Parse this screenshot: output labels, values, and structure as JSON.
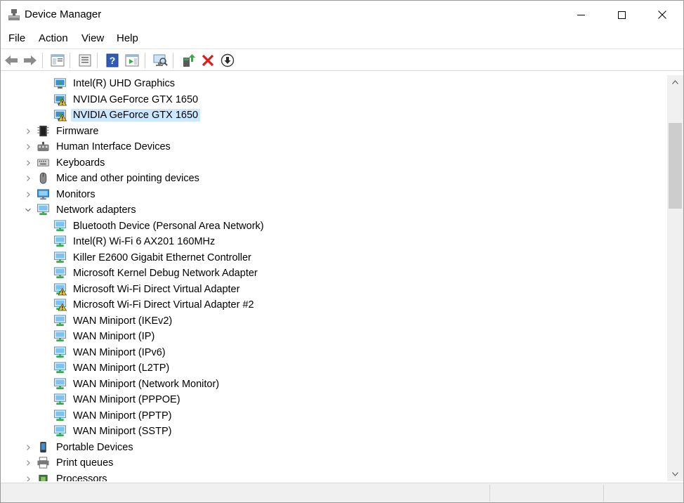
{
  "window": {
    "title": "Device Manager",
    "controls": {
      "minimize": "minimize",
      "maximize": "maximize",
      "close": "close"
    }
  },
  "menu": {
    "items": [
      {
        "label": "File"
      },
      {
        "label": "Action"
      },
      {
        "label": "View"
      },
      {
        "label": "Help"
      }
    ]
  },
  "toolbar": {
    "buttons": [
      {
        "icon": "back-arrow-icon"
      },
      {
        "icon": "forward-arrow-icon"
      },
      {
        "icon": "show-hide-console-tree-icon"
      },
      {
        "icon": "properties-icon"
      },
      {
        "icon": "help-icon"
      },
      {
        "icon": "action-pane-icon"
      },
      {
        "icon": "scan-hardware-changes-icon"
      },
      {
        "icon": "update-driver-icon"
      },
      {
        "icon": "uninstall-device-icon"
      },
      {
        "icon": "disable-device-icon"
      }
    ]
  },
  "tree": {
    "rows": [
      {
        "label": "Intel(R) UHD Graphics",
        "level": 2,
        "icon": "display-adapter-icon",
        "warning": false
      },
      {
        "label": "NVIDIA GeForce GTX 1650",
        "level": 2,
        "icon": "display-adapter-icon",
        "warning": true
      },
      {
        "label": "NVIDIA GeForce GTX 1650",
        "level": 2,
        "icon": "display-adapter-icon",
        "warning": true,
        "selected": true
      },
      {
        "label": "Firmware",
        "level": 1,
        "icon": "firmware-icon",
        "expander": "collapsed"
      },
      {
        "label": "Human Interface Devices",
        "level": 1,
        "icon": "hid-icon",
        "expander": "collapsed"
      },
      {
        "label": "Keyboards",
        "level": 1,
        "icon": "keyboard-icon",
        "expander": "collapsed"
      },
      {
        "label": "Mice and other pointing devices",
        "level": 1,
        "icon": "mouse-icon",
        "expander": "collapsed"
      },
      {
        "label": "Monitors",
        "level": 1,
        "icon": "monitor-icon",
        "expander": "collapsed"
      },
      {
        "label": "Network adapters",
        "level": 1,
        "icon": "network-adapter-icon",
        "expander": "expanded"
      },
      {
        "label": "Bluetooth Device (Personal Area Network)",
        "level": 2,
        "icon": "network-adapter-icon",
        "warning": false
      },
      {
        "label": "Intel(R) Wi-Fi 6 AX201 160MHz",
        "level": 2,
        "icon": "network-adapter-icon",
        "warning": false
      },
      {
        "label": "Killer E2600 Gigabit Ethernet Controller",
        "level": 2,
        "icon": "network-adapter-icon",
        "warning": false
      },
      {
        "label": "Microsoft Kernel Debug Network Adapter",
        "level": 2,
        "icon": "network-adapter-icon",
        "warning": false
      },
      {
        "label": "Microsoft Wi-Fi Direct Virtual Adapter",
        "level": 2,
        "icon": "network-adapter-icon",
        "warning": true
      },
      {
        "label": "Microsoft Wi-Fi Direct Virtual Adapter #2",
        "level": 2,
        "icon": "network-adapter-icon",
        "warning": true
      },
      {
        "label": "WAN Miniport (IKEv2)",
        "level": 2,
        "icon": "network-adapter-icon",
        "warning": false
      },
      {
        "label": "WAN Miniport (IP)",
        "level": 2,
        "icon": "network-adapter-icon",
        "warning": false
      },
      {
        "label": "WAN Miniport (IPv6)",
        "level": 2,
        "icon": "network-adapter-icon",
        "warning": false
      },
      {
        "label": "WAN Miniport (L2TP)",
        "level": 2,
        "icon": "network-adapter-icon",
        "warning": false
      },
      {
        "label": "WAN Miniport (Network Monitor)",
        "level": 2,
        "icon": "network-adapter-icon",
        "warning": false
      },
      {
        "label": "WAN Miniport (PPPOE)",
        "level": 2,
        "icon": "network-adapter-icon",
        "warning": false
      },
      {
        "label": "WAN Miniport (PPTP)",
        "level": 2,
        "icon": "network-adapter-icon",
        "warning": false
      },
      {
        "label": "WAN Miniport (SSTP)",
        "level": 2,
        "icon": "network-adapter-icon",
        "warning": false
      },
      {
        "label": "Portable Devices",
        "level": 1,
        "icon": "portable-device-icon",
        "expander": "collapsed"
      },
      {
        "label": "Print queues",
        "level": 1,
        "icon": "printer-icon",
        "expander": "collapsed"
      },
      {
        "label": "Processors",
        "level": 1,
        "icon": "processor-icon",
        "expander": "collapsed"
      }
    ]
  },
  "colors": {
    "selection": "#cce8ff",
    "warning": "#f5c518",
    "network_green": "#3aa84a",
    "monitor_blue": "#3b8fd8"
  }
}
